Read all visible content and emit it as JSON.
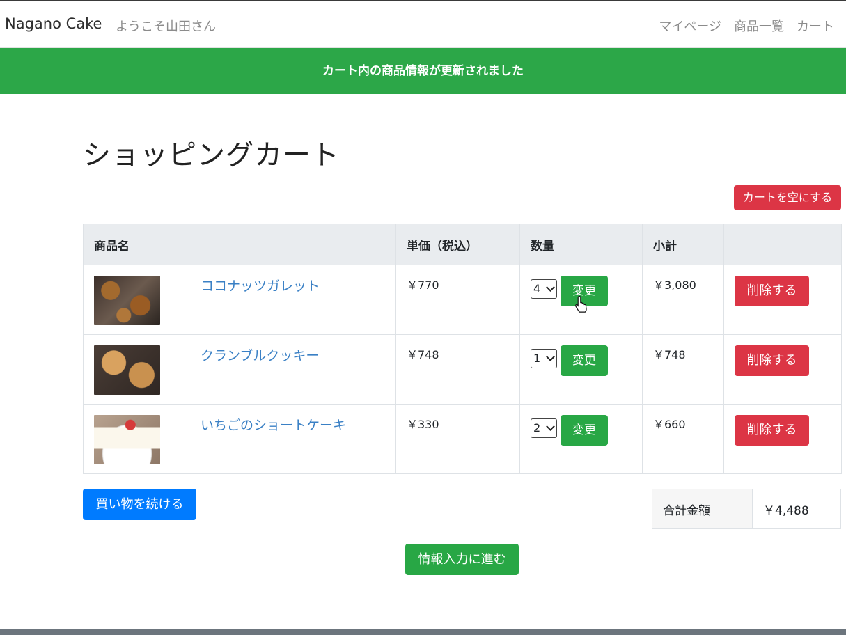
{
  "header": {
    "brand": "Nagano Cake",
    "welcome": "ようこそ山田さん",
    "nav": [
      "マイページ",
      "商品一覧",
      "カート"
    ]
  },
  "flash": "カート内の商品情報が更新されました",
  "page_title": "ショッピングカート",
  "empty_cart_label": "カートを空にする",
  "table": {
    "headers": [
      "商品名",
      "単価（税込）",
      "数量",
      "小計",
      ""
    ],
    "rows": [
      {
        "image": "coconut-galette-photo",
        "name": "ココナッツガレット",
        "price": "￥770",
        "qty": "4",
        "change": "変更",
        "subtotal": "￥3,080",
        "delete": "削除する"
      },
      {
        "image": "crumble-cookie-photo",
        "name": "クランブルクッキー",
        "price": "￥748",
        "qty": "1",
        "change": "変更",
        "subtotal": "￥748",
        "delete": "削除する"
      },
      {
        "image": "strawberry-shortcake-photo",
        "name": "いちごのショートケーキ",
        "price": "￥330",
        "qty": "2",
        "change": "変更",
        "subtotal": "￥660",
        "delete": "削除する"
      }
    ]
  },
  "continue_label": "買い物を続ける",
  "total": {
    "label": "合計金額",
    "value": "￥4,488"
  },
  "proceed_label": "情報入力に進む",
  "colors": {
    "success": "#28a745",
    "danger": "#dc3545",
    "primary": "#007bff",
    "link": "#3a80c5"
  }
}
